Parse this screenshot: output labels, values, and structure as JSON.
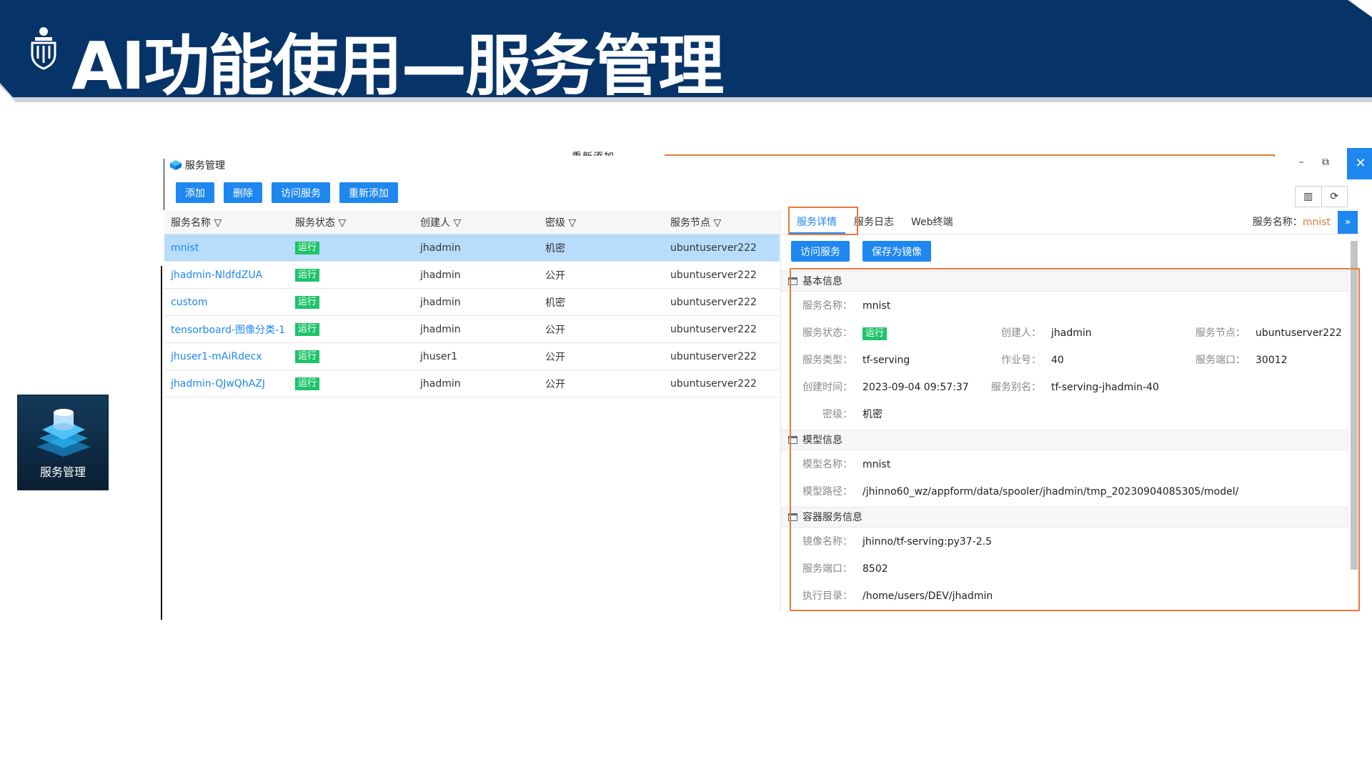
{
  "slide_title": "AI功能使用—服务管理",
  "app_tile_label": "服务管理",
  "window": {
    "title": "服务管理",
    "ghost_text": "重新添加",
    "minimize": "–",
    "restore": "⧉",
    "close": "✕"
  },
  "toolbar": {
    "add": "添加",
    "delete": "删除",
    "visit": "访问服务",
    "re_add": "重新添加",
    "columns_icon": "columns-icon",
    "refresh_icon": "refresh-icon"
  },
  "table": {
    "headers": [
      "服务名称",
      "服务状态",
      "创建人",
      "密级",
      "服务节点"
    ],
    "rows": [
      {
        "name": "mnist",
        "status": "运行",
        "creator": "jhadmin",
        "level": "机密",
        "node": "ubuntuserver222"
      },
      {
        "name": "jhadmin-NldfdZUA",
        "status": "运行",
        "creator": "jhadmin",
        "level": "公开",
        "node": "ubuntuserver222"
      },
      {
        "name": "custom",
        "status": "运行",
        "creator": "jhadmin",
        "level": "机密",
        "node": "ubuntuserver222"
      },
      {
        "name": "tensorboard-图像分类-1",
        "status": "运行",
        "creator": "jhadmin",
        "level": "公开",
        "node": "ubuntuserver222"
      },
      {
        "name": "jhuser1-mAiRdecx",
        "status": "运行",
        "creator": "jhuser1",
        "level": "公开",
        "node": "ubuntuserver222"
      },
      {
        "name": "jhadmin-QJwQhAZJ",
        "status": "运行",
        "creator": "jhadmin",
        "level": "公开",
        "node": "ubuntuserver222"
      }
    ]
  },
  "detail": {
    "tabs": [
      "服务详情",
      "服务日志",
      "Web终端"
    ],
    "service_name_label": "服务名称：",
    "service_name_value": "mnist",
    "visit_btn": "访问服务",
    "save_image_btn": "保存为镜像",
    "sections": {
      "basic": "基本信息",
      "model": "模型信息",
      "container": "容器服务信息"
    },
    "basic": {
      "name_label": "服务名称：",
      "name": "mnist",
      "status_label": "服务状态：",
      "status": "运行",
      "creator_label": "创建人：",
      "creator": "jhadmin",
      "node_label": "服务节点：",
      "node": "ubuntuserver222",
      "type_label": "服务类型：",
      "type": "tf-serving",
      "job_label": "作业号：",
      "job": "40",
      "port_label": "服务端口：",
      "port": "30012",
      "time_label": "创建时间：",
      "time": "2023-09-04 09:57:37",
      "alias_label": "服务别名：",
      "alias": "tf-serving-jhadmin-40",
      "level_label": "密级：",
      "level": "机密"
    },
    "model": {
      "name_label": "模型名称：",
      "name": "mnist",
      "path_label": "模型路径：",
      "path": "/jhinno60_wz/appform/data/spooler/jhadmin/tmp_20230904085305/model/"
    },
    "container": {
      "image_label": "镜像名称：",
      "image": "jhinno/tf-serving:py37-2.5",
      "port_label": "服务端口：",
      "port": "8502",
      "dir_label": "执行目录：",
      "dir": "/home/users/DEV/jhadmin"
    }
  },
  "colors": {
    "banner": "#063468",
    "accent": "#1e87f0",
    "highlight": "#e87a3c",
    "running": "#1ec46a"
  }
}
